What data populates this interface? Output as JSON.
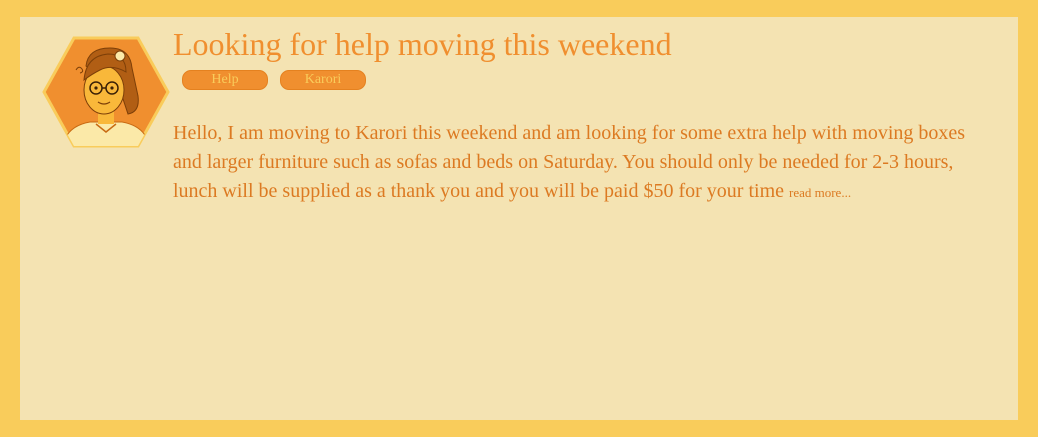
{
  "post": {
    "title": "Looking for help moving this weekend",
    "tags": [
      "Help",
      "Karori"
    ],
    "body": "Hello, I am moving to Karori this weekend and am looking for some extra help with moving boxes and larger furniture such as sofas and beds on Saturday. You should only be needed for 2-3 hours, lunch will be supplied as a thank you and you will be paid $50 for your time",
    "read_more": "read more..."
  },
  "avatar": {
    "icon": "user-avatar-icon"
  },
  "colors": {
    "page_background": "#f9cc5b",
    "card_background": "#f4e3b2",
    "accent": "#f08f2f",
    "text": "#dc7a22",
    "tag_text": "#f9cc5b"
  }
}
